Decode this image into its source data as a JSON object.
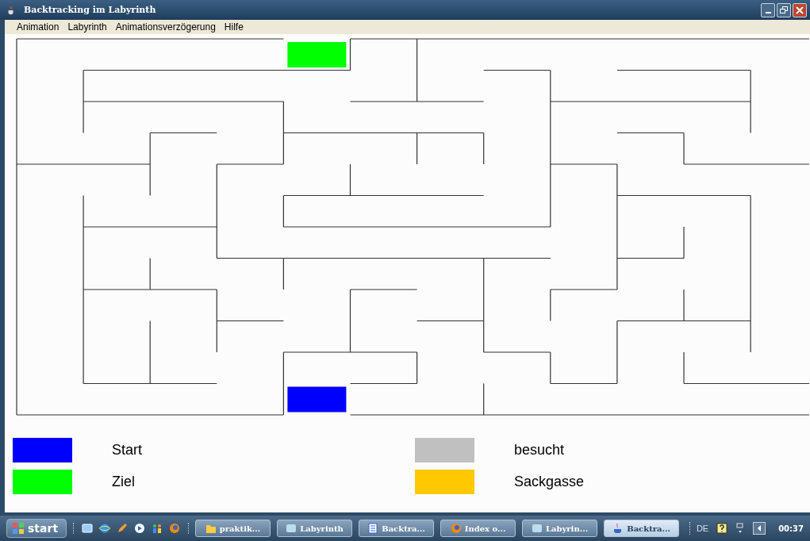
{
  "window": {
    "title": "Backtracking im Labyrinth"
  },
  "menu": [
    "Animation",
    "Labyrinth",
    "Animationsverzögerung",
    "Hilfe"
  ],
  "legend": [
    {
      "label": "Start",
      "color": "#0000ff"
    },
    {
      "label": "Ziel",
      "color": "#00ff00"
    },
    {
      "label": "besucht",
      "color": "#c0c0c0"
    },
    {
      "label": "Sackgasse",
      "color": "#ffc800"
    }
  ],
  "taskbar": {
    "start": "start",
    "tasks": [
      {
        "label": "praktik...",
        "kind": "folder",
        "selected": false
      },
      {
        "label": "Labyrinth",
        "kind": "window",
        "selected": false
      },
      {
        "label": "Backtra...",
        "kind": "document",
        "selected": false
      },
      {
        "label": "Index o...",
        "kind": "browser",
        "selected": false
      },
      {
        "label": "Labyrin...",
        "kind": "window",
        "selected": false
      },
      {
        "label": "Backtra...",
        "kind": "java",
        "selected": true
      }
    ],
    "language": "DE",
    "clock": "00:37"
  }
}
